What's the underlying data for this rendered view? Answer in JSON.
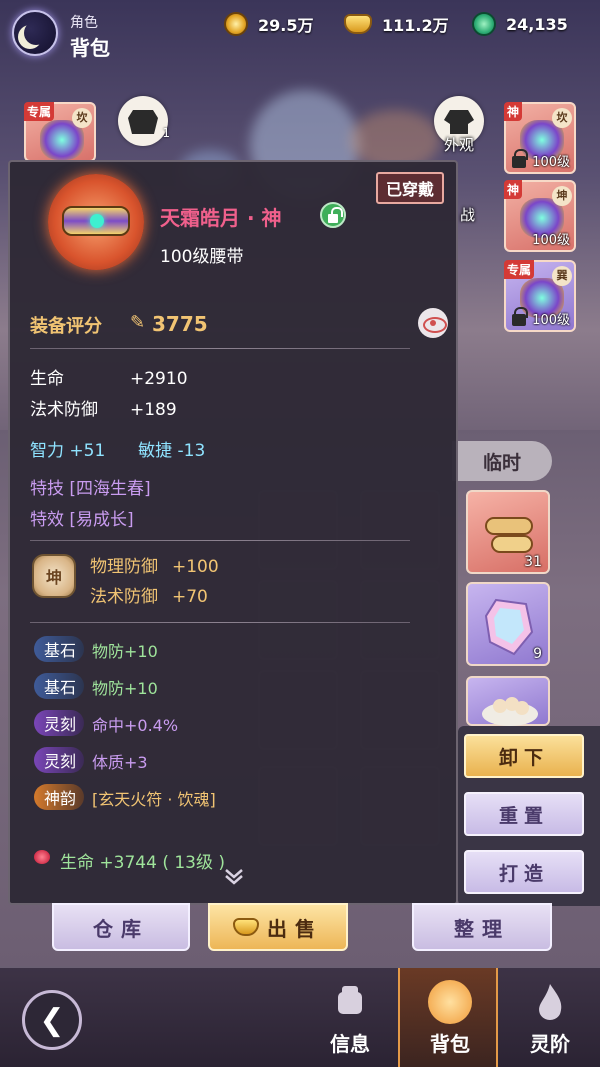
{
  "header": {
    "subtitle": "角色",
    "title": "背包",
    "currencies": [
      {
        "icon": "copper-coin-icon",
        "value": "29.5万"
      },
      {
        "icon": "gold-ingot-icon",
        "value": "111.2万"
      },
      {
        "icon": "jade-dragon-icon",
        "value": "24,135"
      }
    ]
  },
  "scene": {
    "left_slot": {
      "tag": "专属",
      "trigram": "坎"
    },
    "armor_count": "1",
    "outfit_label": "外观",
    "battle_label": "战",
    "right_slots": [
      {
        "tag": "神",
        "trigram": "坎",
        "level": "100级"
      },
      {
        "tag": "神",
        "trigram": "坤",
        "level": "100级"
      },
      {
        "tag": "专属",
        "trigram": "巽",
        "level": "100级"
      }
    ]
  },
  "inventory": {
    "temp_tab": "临时",
    "temp_items": [
      {
        "icon": "scroll-bundle-icon",
        "count": "31"
      },
      {
        "icon": "rainbow-crystal-icon",
        "count": "9"
      },
      {
        "icon": "dumpling-bowl-icon",
        "count": ""
      }
    ]
  },
  "panel": {
    "item_name": "天霜皓月 · 神",
    "worn_label": "已穿戴",
    "item_type": "100级腰带",
    "score_label": "装备评分",
    "score_value": "3775",
    "base_stats": [
      {
        "key": "生命",
        "value": "+2910"
      },
      {
        "key": "法术防御",
        "value": "+189"
      }
    ],
    "attr_line": {
      "a_key": "智力",
      "a_val": "+51",
      "b_key": "敏捷",
      "b_val": "-13"
    },
    "skill_line": "特技 [四海生春]",
    "effect_line": "特效 [易成长]",
    "trigram_badge": "坤",
    "trigram_stats": [
      {
        "key": "物理防御",
        "value": "+100"
      },
      {
        "key": "法术防御",
        "value": "+70"
      }
    ],
    "gems": [
      {
        "tag": "基石",
        "text": "物防+10"
      },
      {
        "tag": "基石",
        "text": "物防+10"
      },
      {
        "tag": "灵刻",
        "text": "命中+0.4%"
      },
      {
        "tag": "灵刻",
        "text": "体质+3"
      },
      {
        "tag": "神韵",
        "text": "[玄天火符 · 饮魂]"
      }
    ],
    "bottom_stat": "生命 +3744 ( 13级 )"
  },
  "actions": {
    "unequip": "卸下",
    "reset": "重置",
    "forge": "打造"
  },
  "bottom_buttons": {
    "warehouse": "仓库",
    "sell": "出售",
    "sort": "整理"
  },
  "nav": {
    "info": "信息",
    "bag": "背包",
    "spirit": "灵阶"
  },
  "colors": {
    "item_name": "#f0608c",
    "score": "#f1c473",
    "primary_button": "#e9b24f"
  }
}
